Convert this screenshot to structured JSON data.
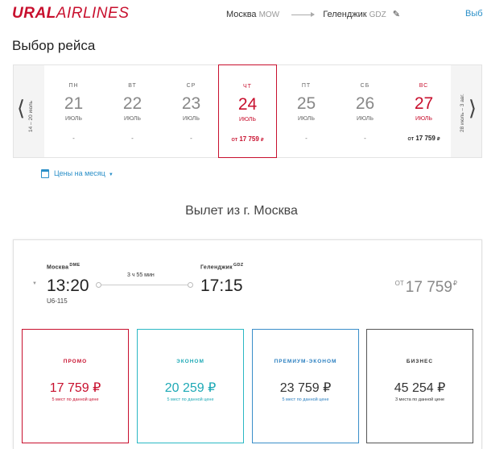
{
  "header": {
    "logo_bold": "URAL",
    "logo_light": "AIRLINES",
    "origin_city": "Москва",
    "origin_code": "MOW",
    "dest_city": "Геленджик",
    "dest_code": "GDZ",
    "right_link": "Выб"
  },
  "page_title": "Выбор рейса",
  "date_strip": {
    "prev_range": "14 – 20 июль",
    "next_range": "28 июль – 3 авг.",
    "days": [
      {
        "dow": "ПН",
        "num": "21",
        "month": "ИЮЛЬ",
        "price": "-",
        "price_currency": ""
      },
      {
        "dow": "ВТ",
        "num": "22",
        "month": "ИЮЛЬ",
        "price": "-",
        "price_currency": ""
      },
      {
        "dow": "СР",
        "num": "23",
        "month": "ИЮЛЬ",
        "price": "-",
        "price_currency": ""
      },
      {
        "dow": "ЧТ",
        "num": "24",
        "month": "ИЮЛЬ",
        "price_prefix": "ОТ",
        "price": "17 759",
        "price_currency": "₽"
      },
      {
        "dow": "ПТ",
        "num": "25",
        "month": "ИЮЛЬ",
        "price": "-",
        "price_currency": ""
      },
      {
        "dow": "СБ",
        "num": "26",
        "month": "ИЮЛЬ",
        "price": "-",
        "price_currency": ""
      },
      {
        "dow": "ВС",
        "num": "27",
        "month": "ИЮЛЬ",
        "price_prefix": "ОТ",
        "price": "17 759",
        "price_currency": "₽"
      }
    ]
  },
  "month_prices_label": "Цены на месяц",
  "departure_title": "Вылет из г. Москва",
  "flight": {
    "dep_city": "Москва",
    "dep_code": "DME",
    "dep_time": "13:20",
    "arr_city": "Геленджик",
    "arr_code": "GDZ",
    "arr_time": "17:15",
    "duration": "3 ч 55 мин",
    "flight_number": "U6-115",
    "from_prefix": "ОТ",
    "from_price": "17 759",
    "from_currency": "₽"
  },
  "fares": {
    "promo": {
      "name": "ПРОМО",
      "price": "17 759 ₽",
      "note": "5 мест по данной цене"
    },
    "econom": {
      "name": "ЭКОНОМ",
      "price": "20 259 ₽",
      "note": "5 мест по данной цене"
    },
    "premium": {
      "name": "ПРЕМИУМ-ЭКОНОМ",
      "price": "23 759 ₽",
      "note": "5 мест по данной цене"
    },
    "business": {
      "name": "БИЗНЕС",
      "price": "45 254 ₽",
      "note": "3 места по данной цене"
    }
  },
  "colors": {
    "brand_red": "#c8102e",
    "link_blue": "#2a8fc8",
    "econom_teal": "#2bb8c4",
    "premium_blue": "#3a8ec9"
  }
}
